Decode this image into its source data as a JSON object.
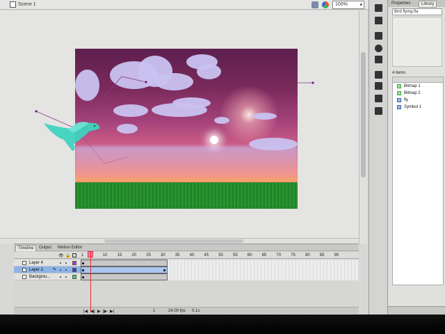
{
  "scene": {
    "label": "Scene 1",
    "zoom": "100%"
  },
  "timeline": {
    "tabs": [
      "Timeline",
      "Output",
      "Motion Editor"
    ],
    "frame_numbers": [
      "1",
      "5",
      "10",
      "15",
      "20",
      "25",
      "30",
      "35",
      "40",
      "45",
      "50",
      "55",
      "60",
      "65",
      "70",
      "75",
      "80",
      "85",
      "90"
    ],
    "layers": [
      {
        "name": "Layer 4",
        "color": "#b03bd8"
      },
      {
        "name": "Layer 2",
        "color": "#3a3ad8"
      },
      {
        "name": "Backgrou...",
        "color": "#3bd85a"
      }
    ],
    "status": {
      "frame": "1",
      "fps": "24.00 fps",
      "time": "0.1s"
    }
  },
  "library": {
    "tabs": [
      "Properties",
      "Library"
    ],
    "document": "Bird flying.fla",
    "count": "4 items",
    "items": [
      {
        "name": "Bitmap 1",
        "type": "bitmap"
      },
      {
        "name": "Bitmap 2",
        "type": "bitmap"
      },
      {
        "name": "fly",
        "type": "symbol"
      },
      {
        "name": "Symbol 1",
        "type": "symbol"
      }
    ]
  },
  "colors": {
    "selected_layer": "#8eb4e6",
    "playhead": "#ee2233",
    "bird": "#3fd2c0"
  }
}
